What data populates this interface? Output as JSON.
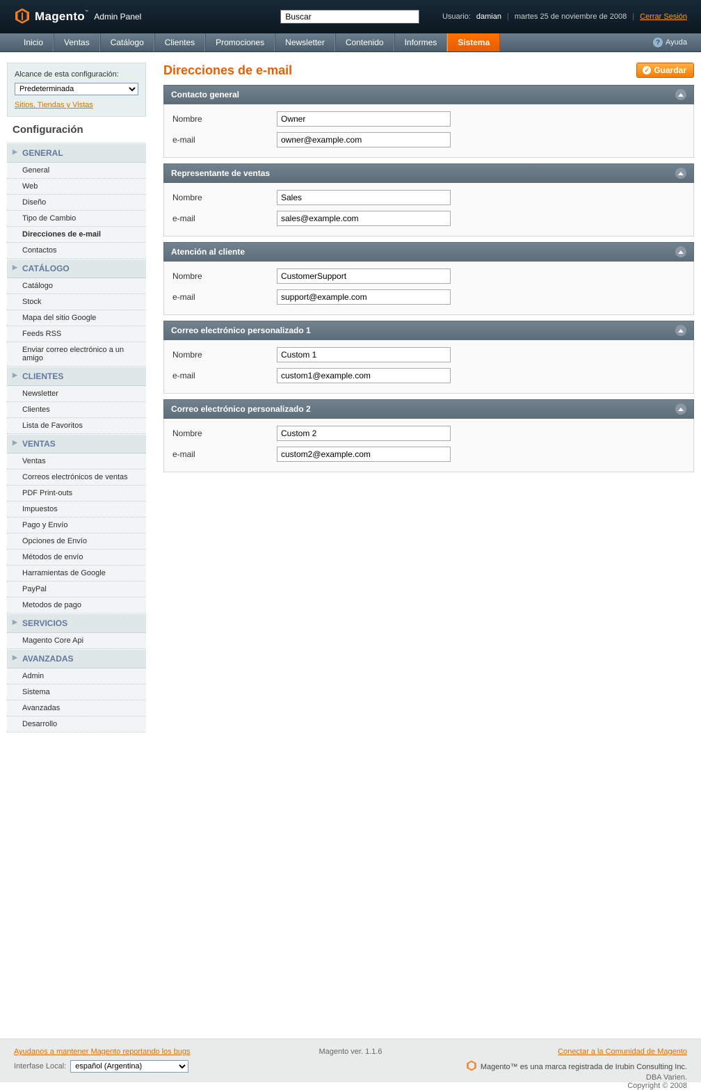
{
  "header": {
    "brand": "Magento",
    "brand_sub": "Admin Panel",
    "search_placeholder": "Buscar",
    "user_label": "Usuario:",
    "user_name": "damian",
    "date": "martes 25 de noviembre de 2008",
    "logout": "Cerrar Sesión"
  },
  "nav": {
    "items": [
      "Inicio",
      "Ventas",
      "Catálogo",
      "Clientes",
      "Promociones",
      "Newsletter",
      "Contenido",
      "Informes",
      "Sistema"
    ],
    "active": "Sistema",
    "help": "Ayuda"
  },
  "scope": {
    "label": "Alcance de esta configuración:",
    "select": "Predeterminada",
    "link": "Sitios, Tiendas y Vistas"
  },
  "config_title": "Configuración",
  "sidebar": [
    {
      "title": "GENERAL",
      "items": [
        "General",
        "Web",
        "Diseño",
        "Tipo de Cambio",
        "Direcciones de e-mail",
        "Contactos"
      ],
      "active": "Direcciones de e-mail"
    },
    {
      "title": "CATÁLOGO",
      "items": [
        "Catálogo",
        "Stock",
        "Mapa del sitio Google",
        "Feeds RSS",
        "Enviar correo electrónico a un amigo"
      ]
    },
    {
      "title": "CLIENTES",
      "items": [
        "Newsletter",
        "Clientes",
        "Lista de Favoritos"
      ]
    },
    {
      "title": "VENTAS",
      "items": [
        "Ventas",
        "Correos electrónicos de ventas",
        "PDF Print-outs",
        "Impuestos",
        "Pago y Envío",
        "Opciones de Envío",
        "Métodos de envío",
        "Harramientas de Google",
        "PayPal",
        "Metodos de pago"
      ]
    },
    {
      "title": "SERVICIOS",
      "items": [
        "Magento Core Api"
      ]
    },
    {
      "title": "AVANZADAS",
      "items": [
        "Admin",
        "Sistema",
        "Avanzadas",
        "Desarrollo"
      ]
    }
  ],
  "page": {
    "title": "Direcciones de e-mail",
    "save": "Guardar"
  },
  "labels": {
    "name": "Nombre",
    "email": "e-mail"
  },
  "fieldsets": [
    {
      "title": "Contacto general",
      "name": "Owner",
      "email": "owner@example.com"
    },
    {
      "title": "Representante de ventas",
      "name": "Sales",
      "email": "sales@example.com"
    },
    {
      "title": "Atención al cliente",
      "name": "CustomerSupport",
      "email": "support@example.com"
    },
    {
      "title": "Correo electrónico personalizado 1",
      "name": "Custom 1",
      "email": "custom1@example.com"
    },
    {
      "title": "Correo electrónico personalizado 2",
      "name": "Custom 2",
      "email": "custom2@example.com"
    }
  ],
  "footer": {
    "bug": "Ayudanos a mantener Magento reportando los bugs",
    "locale_label": "Interfase Local:",
    "locale_value": "español (Argentina)",
    "version": "Magento ver. 1.1.6",
    "connect": "Conectar a la Comunidad de Magento",
    "trademark": "Magento™ es una marca registrada de Irubin Consulting Inc.",
    "dba": "DBA Varien.",
    "copyright": "Copyright © 2008"
  }
}
